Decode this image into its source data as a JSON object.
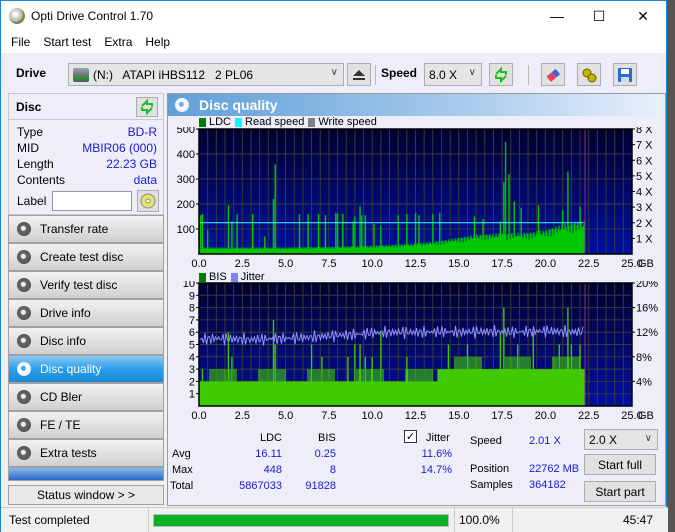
{
  "window": {
    "title": "Opti Drive Control 1.70",
    "controls": {
      "minimize": "—",
      "maximize": "☐",
      "close": "✕"
    }
  },
  "menu": [
    "File",
    "Start test",
    "Extra",
    "Help"
  ],
  "toolbar": {
    "drive_label": "Drive",
    "drive_value": "(N:)   ATAPI iHBS112   2 PL06",
    "speed_label": "Speed",
    "speed_value": "8.0 X",
    "icons": [
      "eject-icon",
      "refresh-icon",
      "erase-icon",
      "settings-icon",
      "save-icon"
    ]
  },
  "disc": {
    "title": "Disc",
    "rows": [
      {
        "key": "Type",
        "value": "BD-R"
      },
      {
        "key": "MID",
        "value": "MBIR06 (000)"
      },
      {
        "key": "Length",
        "value": "22.23 GB"
      },
      {
        "key": "Contents",
        "value": "data"
      }
    ],
    "label_key": "Label",
    "label_value": ""
  },
  "nav": [
    {
      "label": "Transfer rate",
      "active": false
    },
    {
      "label": "Create test disc",
      "active": false
    },
    {
      "label": "Verify test disc",
      "active": false
    },
    {
      "label": "Drive info",
      "active": false
    },
    {
      "label": "Disc info",
      "active": false
    },
    {
      "label": "Disc quality",
      "active": true
    },
    {
      "label": "CD Bler",
      "active": false
    },
    {
      "label": "FE / TE",
      "active": false
    },
    {
      "label": "Extra tests",
      "active": false
    }
  ],
  "status_window_label": "Status window > >",
  "panel": {
    "title": "Disc quality"
  },
  "chart_data": [
    {
      "type": "bar",
      "title": "LDC",
      "legend": [
        {
          "name": "LDC",
          "color": "#008000"
        },
        {
          "name": "Read speed",
          "color": "#00ffff"
        },
        {
          "name": "Write speed",
          "color": "#808080"
        }
      ],
      "legend_position": "top-left",
      "xlabel": "GB",
      "x_ticks": [
        "0.0",
        "2.5",
        "5.0",
        "7.5",
        "10.0",
        "12.5",
        "15.0",
        "17.5",
        "20.0",
        "22.5",
        "25.0"
      ],
      "xlim": [
        0,
        25
      ],
      "ylim_left": [
        0,
        500
      ],
      "y_ticks_left": [
        "100",
        "200",
        "300",
        "400",
        "500"
      ],
      "ylim_right": [
        0,
        8
      ],
      "y_ticks_right": [
        "1 X",
        "2 X",
        "3 X",
        "4 X",
        "5 X",
        "6 X",
        "7 X",
        "8 X"
      ],
      "grid": true,
      "end_marker_gb": 22.23,
      "read_speed_x": 2.0,
      "ldc_baseline": [
        [
          0,
          22
        ],
        [
          2.5,
          22
        ],
        [
          5,
          22
        ],
        [
          7.5,
          24
        ],
        [
          10,
          28
        ],
        [
          12.5,
          35
        ],
        [
          14,
          45
        ],
        [
          15,
          55
        ],
        [
          16,
          65
        ],
        [
          17.5,
          70
        ],
        [
          19,
          72
        ],
        [
          20,
          80
        ],
        [
          21,
          100
        ],
        [
          22.23,
          110
        ]
      ],
      "ldc_spikes": [
        [
          0.1,
          155
        ],
        [
          0.2,
          160
        ],
        [
          0.5,
          95
        ],
        [
          1.7,
          195
        ],
        [
          1.9,
          130
        ],
        [
          2.2,
          160
        ],
        [
          3.1,
          160
        ],
        [
          3.8,
          70
        ],
        [
          4.3,
          220
        ],
        [
          4.4,
          358
        ],
        [
          5.8,
          160
        ],
        [
          6.3,
          160
        ],
        [
          6.9,
          160
        ],
        [
          7.3,
          155
        ],
        [
          7.9,
          165
        ],
        [
          8.0,
          160
        ],
        [
          8.3,
          160
        ],
        [
          8.9,
          130
        ],
        [
          9.0,
          150
        ],
        [
          9.3,
          190
        ],
        [
          9.4,
          155
        ],
        [
          9.6,
          155
        ],
        [
          10.1,
          120
        ],
        [
          10.5,
          115
        ],
        [
          11.5,
          155
        ],
        [
          12.0,
          160
        ],
        [
          12.5,
          165
        ],
        [
          12.7,
          155
        ],
        [
          13.5,
          160
        ],
        [
          13.9,
          165
        ],
        [
          15.9,
          150
        ],
        [
          16.4,
          140
        ],
        [
          17.4,
          130
        ],
        [
          17.6,
          288
        ],
        [
          17.7,
          448
        ],
        [
          17.9,
          320
        ],
        [
          18.2,
          210
        ],
        [
          18.6,
          185
        ],
        [
          19.6,
          195
        ],
        [
          21.0,
          175
        ],
        [
          21.3,
          330
        ],
        [
          22.0,
          190
        ]
      ]
    },
    {
      "type": "bar",
      "title": "BIS / Jitter",
      "legend": [
        {
          "name": "BIS",
          "color": "#008000"
        },
        {
          "name": "Jitter",
          "color": "#8080ff"
        }
      ],
      "legend_position": "top-left",
      "xlabel": "GB",
      "x_ticks": [
        "0.0",
        "2.5",
        "5.0",
        "7.5",
        "10.0",
        "12.5",
        "15.0",
        "17.5",
        "20.0",
        "22.5",
        "25.0"
      ],
      "xlim": [
        0,
        25
      ],
      "ylim_left": [
        0,
        10
      ],
      "y_ticks_left": [
        "1",
        "2",
        "3",
        "4",
        "5",
        "6",
        "7",
        "8",
        "9",
        "10"
      ],
      "ylim_right": [
        0,
        20
      ],
      "y_ticks_right": [
        "4%",
        "8%",
        "12%",
        "16%",
        "20%"
      ],
      "grid": true,
      "end_marker_gb": 22.23,
      "bis_baseline": [
        [
          0,
          2
        ],
        [
          10,
          2
        ],
        [
          12.5,
          2
        ],
        [
          15,
          3
        ],
        [
          22.23,
          3
        ]
      ],
      "bis_spikes": [
        [
          0.2,
          3
        ],
        [
          1.7,
          6
        ],
        [
          1.9,
          4
        ],
        [
          4.3,
          7
        ],
        [
          4.4,
          5
        ],
        [
          6.5,
          5
        ],
        [
          7.1,
          4
        ],
        [
          8.6,
          4
        ],
        [
          9.0,
          5
        ],
        [
          9.3,
          5
        ],
        [
          9.6,
          4
        ],
        [
          10.0,
          4
        ],
        [
          10.5,
          6
        ],
        [
          12.0,
          4
        ],
        [
          14.4,
          5
        ],
        [
          15.5,
          5
        ],
        [
          17.4,
          6
        ],
        [
          17.6,
          8
        ],
        [
          18.4,
          5
        ],
        [
          19.3,
          6
        ],
        [
          20.8,
          5
        ],
        [
          21.3,
          8
        ],
        [
          21.5,
          5
        ],
        [
          22.0,
          5
        ]
      ],
      "jitter_pct": [
        [
          0,
          10.8
        ],
        [
          1,
          11.0
        ],
        [
          2,
          10.9
        ],
        [
          3,
          10.8
        ],
        [
          4,
          10.9
        ],
        [
          5,
          11.0
        ],
        [
          6,
          11.1
        ],
        [
          7,
          11.3
        ],
        [
          8,
          11.5
        ],
        [
          9,
          11.6
        ],
        [
          10,
          11.9
        ],
        [
          11,
          12.0
        ],
        [
          12,
          12.0
        ],
        [
          13,
          12.0
        ],
        [
          14,
          12.1
        ],
        [
          15,
          12.0
        ],
        [
          16,
          12.1
        ],
        [
          17,
          12.1
        ],
        [
          18,
          12.0
        ],
        [
          19,
          12.1
        ],
        [
          20,
          12.2
        ],
        [
          21,
          12.1
        ],
        [
          22.23,
          12.0
        ]
      ]
    }
  ],
  "stats": {
    "headers": [
      "LDC",
      "BIS"
    ],
    "rows": [
      {
        "label": "Avg",
        "ldc": "16.11",
        "bis": "0.25",
        "jitter": "11.6%"
      },
      {
        "label": "Max",
        "ldc": "448",
        "bis": "8",
        "jitter": "14.7%"
      },
      {
        "label": "Total",
        "ldc": "5867033",
        "bis": "91828",
        "jitter": ""
      }
    ],
    "jitter_label": "Jitter",
    "jitter_checked": true,
    "speed_label": "Speed",
    "speed_value": "2.01 X",
    "position_label": "Position",
    "position_value": "22762 MB",
    "samples_label": "Samples",
    "samples_value": "364182",
    "speed_select": "2.0 X",
    "start_full": "Start full",
    "start_part": "Start part"
  },
  "statusbar": {
    "text": "Test completed",
    "progress_percent": 100.0,
    "progress_label": "100.0%",
    "elapsed": "45:47"
  }
}
